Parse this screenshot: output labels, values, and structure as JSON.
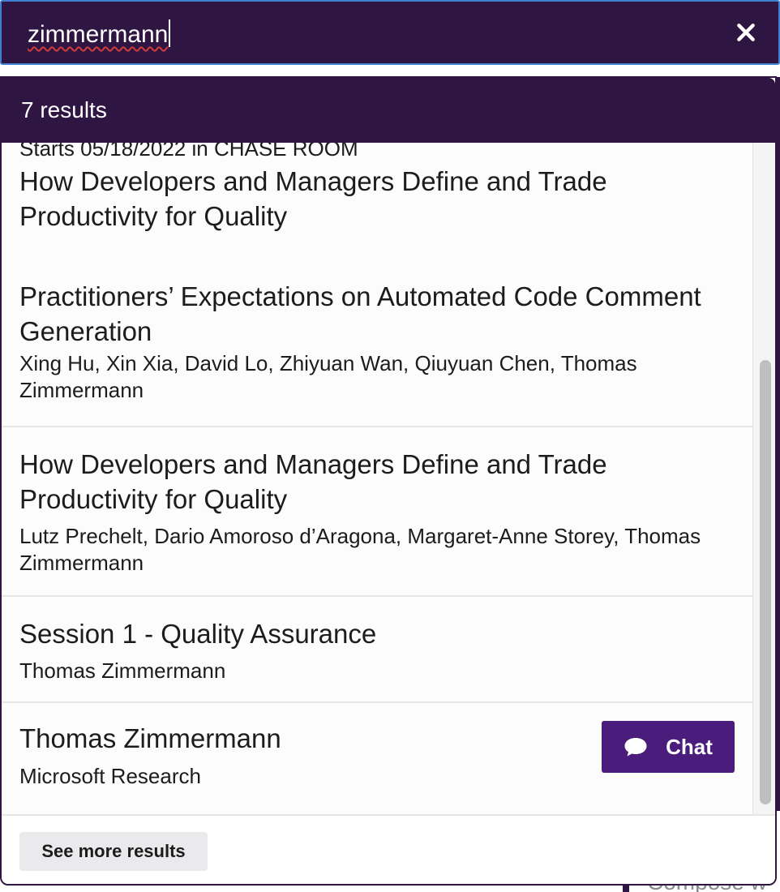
{
  "search": {
    "value": "zimmermann",
    "clear_label": "close-icon"
  },
  "results": {
    "count_label": "7 results",
    "items": [
      {
        "meta": "Starts 05/18/2022 in CHASE ROOM",
        "title": "How Developers and Managers Define and Trade Productivity for Quality"
      },
      {
        "title": "Practitioners’ Expectations on Automated Code Comment Generation",
        "subtitle": "Xing Hu, Xin Xia, David Lo, Zhiyuan Wan, Qiuyuan Chen, Thomas Zimmermann"
      },
      {
        "title": "How Developers and Managers Define and Trade Productivity for Quality",
        "subtitle": "Lutz Prechelt, Dario Amoroso d’Aragona, Margaret-Anne Storey, Thomas Zimmermann"
      },
      {
        "title": "Session 1 - Quality Assurance",
        "subtitle": "Thomas Zimmermann"
      },
      {
        "title": "Thomas Zimmermann",
        "subtitle": "Microsoft Research",
        "action_label": "Chat"
      }
    ],
    "more_label": "See more results"
  },
  "background": {
    "compose_placeholder": "Compose w"
  },
  "colors": {
    "header_bg": "#2f1542",
    "focus_border": "#3f7fd4",
    "chat_button": "#4a1d7c"
  }
}
